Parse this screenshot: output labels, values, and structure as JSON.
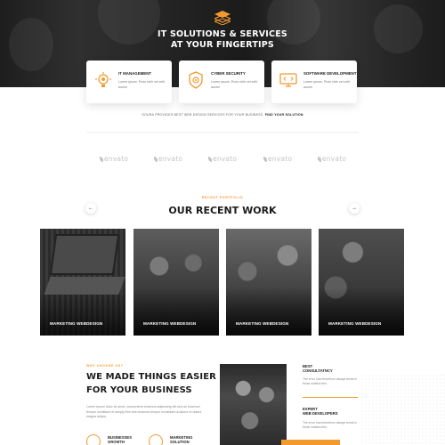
{
  "hero": {
    "title_line1": "IT SOLUTIONS & SERVICES",
    "title_line2": "AT YOUR FINGERTIPS"
  },
  "services": [
    {
      "title": "IT MANAGEMENT",
      "desc": "Lorem ipsum. Proin nibh vel velit auctor",
      "icon": "gear-bulb-icon"
    },
    {
      "title": "CYBER SECURITY",
      "desc": "Lorem ipsum. Proin nibh vel velit auctor",
      "icon": "shield-gear-icon"
    },
    {
      "title": "SOFTWARE DEVELOPMENT",
      "desc": "Lorem ipsum. Proin nibh vel velit auctor",
      "icon": "monitor-code-icon"
    }
  ],
  "tagline": {
    "text": "SOURA PROVIDES BEST WEB DESIGN SERVICES FOR YOUR BUSINESS.",
    "link": "FIND YOUR SOLUTION"
  },
  "brands": [
    "envato",
    "envato",
    "envato",
    "envato",
    "envato"
  ],
  "work": {
    "eyebrow": "RECENT PORTFOLIO",
    "title": "OUR RECENT WORK",
    "prev": "←",
    "next": "→",
    "items": [
      {
        "label": "MARKETING WEBDESIGN"
      },
      {
        "label": "MARKETING WEBDESIGN"
      },
      {
        "label": "MARKETING WEBDESIGN"
      },
      {
        "label": "MARKETING WEBDESIGN"
      }
    ]
  },
  "why": {
    "eyebrow": "WHY CHOOSE US?",
    "title_line1": "WE MADE THINGS EASIER",
    "title_line2": "FOR YOUR BUSINESS",
    "body": "Lorem ipsum dolor sit amet, consectetur eiusmod adipiscing elit sed do eiusmod tempor incididunt et simply free text eiusmod tempor incididunt ut labore et dolore magna aliqua.",
    "features": [
      {
        "line1": "BUSINESSES",
        "line2": "GROWTH"
      },
      {
        "line1": "MARKETING",
        "line2": "SOLUTION"
      }
    ],
    "side": [
      {
        "line1": "BEST",
        "line2": "CONSULTATNCY",
        "desc": "The error man therefrom always fends in these matters this."
      },
      {
        "line1": "EXPERT",
        "line2": "WEB DEVELOPERS",
        "desc": "The error man therefrom always fends in these matters this."
      }
    ]
  },
  "colors": {
    "accent": "#f29a2e",
    "dark": "#1c1c1c"
  }
}
